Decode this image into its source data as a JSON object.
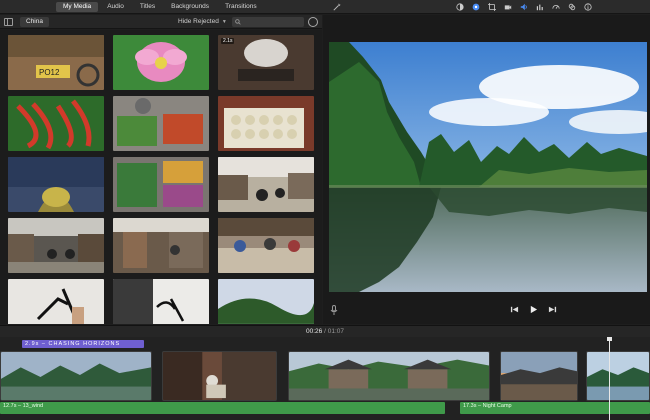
{
  "toolbar": {
    "tabs": [
      {
        "label": "My Media",
        "active": true
      },
      {
        "label": "Audio"
      },
      {
        "label": "Titles"
      },
      {
        "label": "Backgrounds"
      },
      {
        "label": "Transitions"
      }
    ],
    "right_icons": [
      "magic-wand-icon",
      "color-balance-icon",
      "color-correction-icon",
      "crop-icon",
      "stabilization-icon",
      "volume-icon",
      "equalizer-icon",
      "speed-icon",
      "filter-icon",
      "info-icon"
    ]
  },
  "browser": {
    "album": "China",
    "filter": "Hide Rejected",
    "search_placeholder": ""
  },
  "grid": {
    "badges": [
      "",
      "",
      "2.1s",
      "",
      "",
      "",
      "",
      "",
      "",
      "",
      "",
      "",
      "",
      "",
      ""
    ]
  },
  "viewer": {
    "current_time": "00:26",
    "separator": "/",
    "total_time": "01:07"
  },
  "timeline": {
    "title_clip": "2.9s – CHASING HORIZONS",
    "audio_clips": [
      {
        "label": "12.7s – 13_wind"
      },
      {
        "label": "17.3s – Night Camp"
      }
    ]
  },
  "colors": {
    "accent": "#4a8df6",
    "title_track": "#6f5fd0",
    "audio_track": "#3f9a4a"
  }
}
